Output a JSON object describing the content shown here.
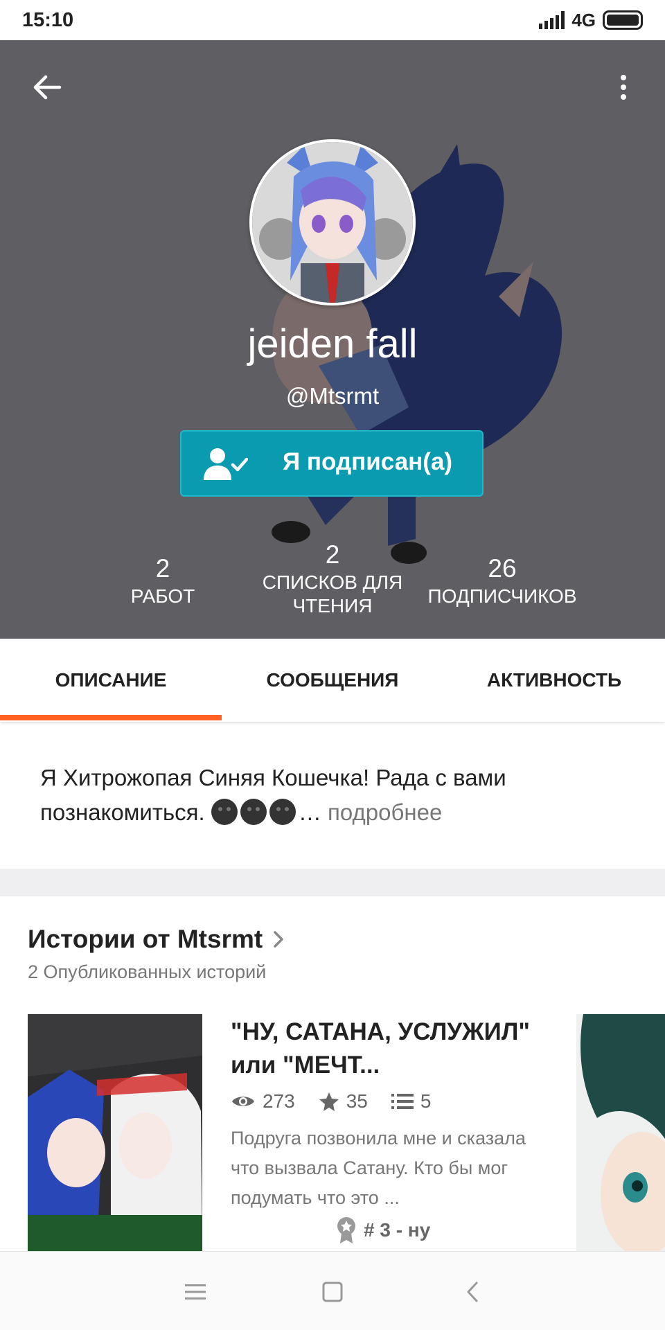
{
  "status_bar": {
    "time": "15:10",
    "network": "4G"
  },
  "profile": {
    "display_name": "jeiden fall",
    "username": "@Mtsrmt",
    "follow_button_label": "Я подписан(а)",
    "stats": [
      {
        "value": "2",
        "label": "РАБОТ"
      },
      {
        "value": "2",
        "label": "СПИСКОВ ДЛЯ ЧТЕНИЯ"
      },
      {
        "value": "26",
        "label": "ПОДПИСЧИКОВ"
      }
    ]
  },
  "tabs": [
    {
      "label": "ОПИСАНИЕ",
      "active": true
    },
    {
      "label": "СООБЩЕНИЯ",
      "active": false
    },
    {
      "label": "АКТИВНОСТЬ",
      "active": false
    }
  ],
  "description": {
    "text": "Я Хитрожопая Синяя Кошечка! Рада с вами познакомиться.",
    "ellipsis": "…",
    "more_link": "подробнее"
  },
  "stories": {
    "title": "Истории от Mtsrmt",
    "subtitle": "2 Опубликованных историй",
    "items": [
      {
        "title": "\"НУ, САТАНА, УСЛУЖИЛ\" или \"МЕЧТ...",
        "views": "273",
        "votes": "35",
        "parts": "5",
        "description": "Подруга позвонила мне и сказала что вызвала Сатану. Кто бы мог подумать что это ...",
        "rank": "# 3 - ну"
      }
    ]
  },
  "colors": {
    "header_bg": "#5f5e63",
    "follow_button": "#0a9bb0",
    "tab_indicator": "#ff6122",
    "divider": "#efeef1"
  },
  "icons": {
    "back": "arrow-left-icon",
    "overflow": "more-vertical-icon",
    "follow": "user-check-icon",
    "views": "eye-icon",
    "votes": "star-icon",
    "parts": "list-icon",
    "rank": "award-icon",
    "nav_menu": "menu-icon",
    "nav_home": "square-icon",
    "nav_back": "chevron-left-icon"
  }
}
